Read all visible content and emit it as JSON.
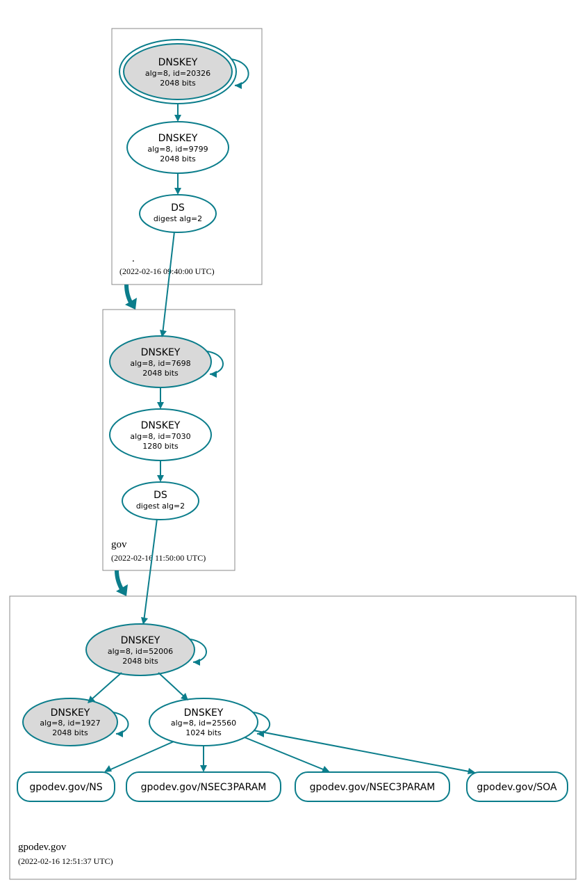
{
  "colors": {
    "teal": "#0b7d8b",
    "shade": "#d9d9d9"
  },
  "zones": {
    "root": {
      "name": ".",
      "timestamp": "(2022-02-16 09:40:00 UTC)"
    },
    "gov": {
      "name": "gov",
      "timestamp": "(2022-02-16 11:50:00 UTC)"
    },
    "gpodev": {
      "name": "gpodev.gov",
      "timestamp": "(2022-02-16 12:51:37 UTC)"
    }
  },
  "nodes": {
    "root_ksk": {
      "title": "DNSKEY",
      "l2": "alg=8, id=20326",
      "l3": "2048 bits"
    },
    "root_zsk": {
      "title": "DNSKEY",
      "l2": "alg=8, id=9799",
      "l3": "2048 bits"
    },
    "root_ds": {
      "title": "DS",
      "l2": "digest alg=2"
    },
    "gov_ksk": {
      "title": "DNSKEY",
      "l2": "alg=8, id=7698",
      "l3": "2048 bits"
    },
    "gov_zsk": {
      "title": "DNSKEY",
      "l2": "alg=8, id=7030",
      "l3": "1280 bits"
    },
    "gov_ds": {
      "title": "DS",
      "l2": "digest alg=2"
    },
    "gp_ksk": {
      "title": "DNSKEY",
      "l2": "alg=8, id=52006",
      "l3": "2048 bits"
    },
    "gp_k2": {
      "title": "DNSKEY",
      "l2": "alg=8, id=1927",
      "l3": "2048 bits"
    },
    "gp_zsk": {
      "title": "DNSKEY",
      "l2": "alg=8, id=25560",
      "l3": "1024 bits"
    },
    "rr_ns": {
      "label": "gpodev.gov/NS"
    },
    "rr_n3p1": {
      "label": "gpodev.gov/NSEC3PARAM"
    },
    "rr_n3p2": {
      "label": "gpodev.gov/NSEC3PARAM"
    },
    "rr_soa": {
      "label": "gpodev.gov/SOA"
    }
  }
}
